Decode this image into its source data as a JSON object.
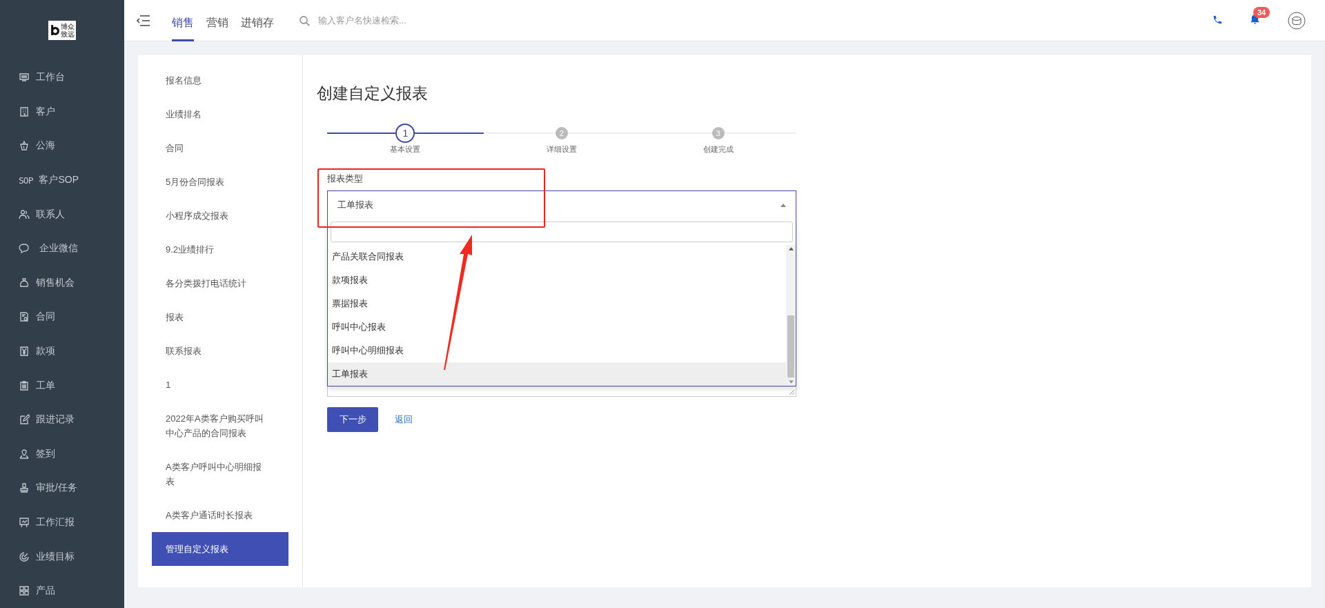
{
  "logo": {
    "lines": [
      "博众",
      "致远"
    ]
  },
  "top_nav": {
    "tabs": [
      {
        "label": "销售",
        "selected": true
      },
      {
        "label": "营销",
        "selected": false
      },
      {
        "label": "进销存",
        "selected": false
      }
    ],
    "search": {
      "placeholder": "输入客户名快速检索..."
    },
    "notifications": {
      "badge": "34"
    }
  },
  "sidebar": {
    "items": [
      {
        "label": "工作台"
      },
      {
        "label": "客户"
      },
      {
        "label": "公海"
      },
      {
        "label": "客户SOP",
        "icon_label": "SOP"
      },
      {
        "label": "联系人"
      },
      {
        "label": "企业微信"
      },
      {
        "label": "销售机会"
      },
      {
        "label": "合同"
      },
      {
        "label": "款项"
      },
      {
        "label": "工单"
      },
      {
        "label": "跟进记录"
      },
      {
        "label": "签到"
      },
      {
        "label": "审批/任务"
      },
      {
        "label": "工作汇报"
      },
      {
        "label": "业绩目标"
      },
      {
        "label": "产品"
      }
    ]
  },
  "report_list": {
    "items": [
      {
        "label": "报名信息",
        "selected": false
      },
      {
        "label": "业绩排名",
        "selected": false
      },
      {
        "label": "合同",
        "selected": false
      },
      {
        "label": "5月份合同报表",
        "selected": false
      },
      {
        "label": "小程序成交报表",
        "selected": false
      },
      {
        "label": "9.2业绩排行",
        "selected": false
      },
      {
        "label": "各分类拨打电话统计",
        "selected": false
      },
      {
        "label": "报表",
        "selected": false
      },
      {
        "label": "联系报表",
        "selected": false
      },
      {
        "label": "1",
        "selected": false
      },
      {
        "label": "2022年A类客户购买呼叫中心产品的合同报表",
        "selected": false
      },
      {
        "label": "A类客户呼叫中心明细报表",
        "selected": false
      },
      {
        "label": "A类客户通话时长报表",
        "selected": false
      },
      {
        "label": "管理自定义报表",
        "selected": true
      }
    ]
  },
  "form": {
    "title": "创建自定义报表",
    "steps": [
      {
        "number": "1",
        "label": "基本设置",
        "active": true
      },
      {
        "number": "2",
        "label": "详细设置",
        "active": false
      },
      {
        "number": "3",
        "label": "创建完成",
        "active": false
      }
    ],
    "field_label": "报表类型",
    "select": {
      "value": "工单报表",
      "expanded": true,
      "options": [
        {
          "label": "产品关联合同报表",
          "selected": false
        },
        {
          "label": "款项报表",
          "selected": false
        },
        {
          "label": "票据报表",
          "selected": false
        },
        {
          "label": "呼叫中心报表",
          "selected": false
        },
        {
          "label": "呼叫中心明细报表",
          "selected": false
        },
        {
          "label": "工单报表",
          "selected": true
        }
      ]
    },
    "buttons": [
      {
        "label": "下一步",
        "kind": "primary"
      },
      {
        "label": "返回",
        "kind": "link"
      }
    ]
  }
}
